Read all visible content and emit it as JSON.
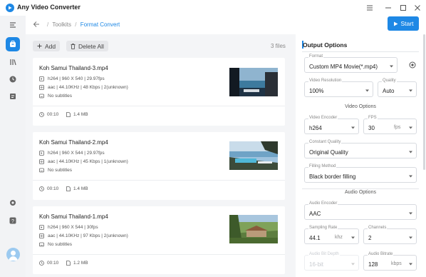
{
  "app": {
    "title": "Any Video Converter"
  },
  "breadcrumb": {
    "root": "Toolkits",
    "separator": "/",
    "current": "Format Convert"
  },
  "toolbar": {
    "start_label": "Start",
    "add_label": "Add",
    "delete_all_label": "Delete All",
    "files_count": "3 files"
  },
  "files": [
    {
      "name": "Koh Samui Thailand-3.mp4",
      "video": "h264 | 960 X 540 | 29.97fps",
      "audio": "aac | 44.10KHz | 48 Kbps | 2(unknown)",
      "subtitles": "No subtitles",
      "duration": "00:10",
      "size": "1.4 MB"
    },
    {
      "name": "Koh Samui Thailand-2.mp4",
      "video": "h264 | 960 X 544 | 29.97fps",
      "audio": "aac | 44.10KHz | 45 Kbps | 1(unknown)",
      "subtitles": "No subtitles",
      "duration": "00:10",
      "size": "1.4 MB"
    },
    {
      "name": "Koh Samui Thailand-1.mp4",
      "video": "h264 | 960 X 544 | 30fps",
      "audio": "aac | 44.10KHz | 97 Kbps | 2(unknown)",
      "subtitles": "No subtitles",
      "duration": "00:10",
      "size": "1.2 MB"
    }
  ],
  "options": {
    "title": "Output Options",
    "format": {
      "label": "Format",
      "value": "Custom MP4 Movie(*.mp4)"
    },
    "resolution": {
      "label": "Video Resolution",
      "value": "100%"
    },
    "quality": {
      "label": "Quality",
      "value": "Auto"
    },
    "video_section": "Video Options",
    "video_encoder": {
      "label": "Video Encoder",
      "value": "h264"
    },
    "fps": {
      "label": "FPS",
      "value": "30",
      "unit": "fps"
    },
    "constant_quality": {
      "label": "Constant Quality",
      "value": "Original Quality"
    },
    "filling_method": {
      "label": "Filling Method",
      "value": "Black border filling"
    },
    "audio_section": "Audio Options",
    "audio_encoder": {
      "label": "Audio Encoder",
      "value": "AAC"
    },
    "sampling_rate": {
      "label": "Sampling Rate",
      "value": "44.1",
      "unit": "khz"
    },
    "channels": {
      "label": "Channels",
      "value": "2"
    },
    "audio_bit_depth": {
      "label": "Audio Bit Depth",
      "value": "16-bit"
    },
    "audio_bitrate": {
      "label": "Audio Bitrate",
      "value": "128",
      "unit": "kbps"
    }
  },
  "colors": {
    "accent": "#1e88e5",
    "sidebar_bg": "#f2f3f5",
    "list_bg": "#f4f5f7"
  }
}
